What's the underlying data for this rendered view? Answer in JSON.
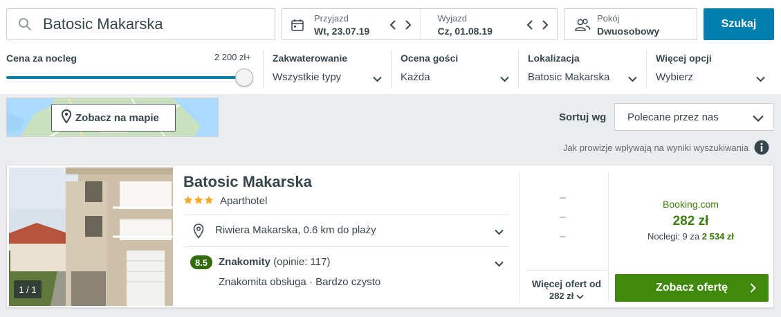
{
  "search": {
    "destination": "Batosic Makarska",
    "button_label": "Szukaj"
  },
  "dates": {
    "checkin_label": "Przyjazd",
    "checkin_value": "Wt, 23.07.19",
    "checkout_label": "Wyjazd",
    "checkout_value": "Cz, 01.08.19"
  },
  "room": {
    "label": "Pokój",
    "value": "Dwuosobowy"
  },
  "filters": {
    "price": {
      "title": "Cena za nocleg",
      "max": "2 200 zł+",
      "level": 1.0
    },
    "accommodation": {
      "title": "Zakwaterowanie",
      "value": "Wszystkie typy"
    },
    "guest_rating": {
      "title": "Ocena gości",
      "value": "Każda"
    },
    "location": {
      "title": "Lokalizacja",
      "value": "Batosic Makarska"
    },
    "more": {
      "title": "Więcej opcji",
      "value": "Wybierz"
    }
  },
  "map": {
    "button_label": "Zobacz na mapie"
  },
  "sort": {
    "label": "Sortuj wg",
    "value": "Polecane przez nas"
  },
  "commission_note": "Jak prowizje wpływają na wyniki wyszukiwania",
  "result": {
    "name": "Batosic Makarska",
    "stars": 3,
    "type": "Aparthotel",
    "location": "Riwiera Makarska, 0.6 km do plaży",
    "rating_score": "8.5",
    "rating_word": "Znakomity",
    "rating_count": "(opinie: 117)",
    "rating_details": "Znakomita obsługa · Bardzo czysto",
    "photo_counter": "1 / 1",
    "alt_offers": [
      "–",
      "–",
      "–"
    ],
    "more_offers_line1": "Więcej ofert od",
    "more_offers_line2": "282 zł",
    "provider": "Booking.com",
    "price": "282 zł",
    "nights_prefix": "Noclegi: 9 za",
    "nights_total": "2 534 zł",
    "deal_button": "Zobacz ofertę"
  },
  "colors": {
    "primary": "#007faf",
    "deal": "#3f8a0d",
    "price": "#3a7d0a",
    "rating": "#316b0c",
    "star": "#f5a623"
  },
  "icons": [
    "search-icon",
    "calendar-icon",
    "chevron-left-icon",
    "chevron-right-icon",
    "guests-icon",
    "chevron-down-icon",
    "map-pin-icon",
    "info-icon",
    "star-icon"
  ]
}
